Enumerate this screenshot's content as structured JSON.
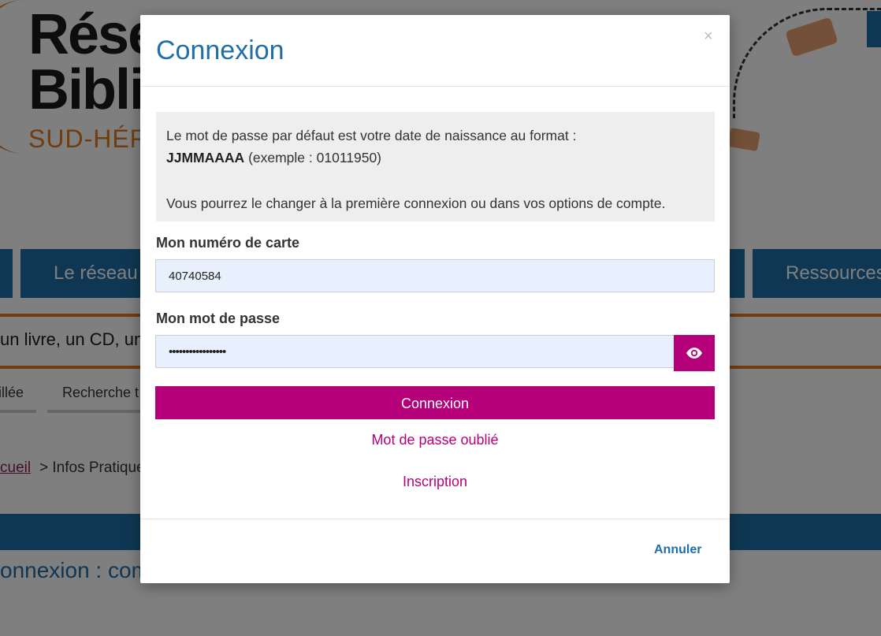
{
  "background": {
    "logo": {
      "line1": "Rése",
      "line2": "Bibli",
      "line3": "SUD-HÉR"
    },
    "nav": {
      "items": [
        "",
        "Le réseau",
        "",
        "Ressources"
      ]
    },
    "search": {
      "placeholder_visible": "un livre, un CD, un"
    },
    "subtabs": [
      "illée",
      "Recherche t"
    ],
    "breadcrumb": {
      "home": "cueil",
      "rest": "> Infos Pratique"
    },
    "heading": "onnexion : com"
  },
  "modal": {
    "title": "Connexion",
    "close_glyph": "×",
    "info": {
      "line1": "Le mot de passe par défaut est votre date de naissance au format :",
      "format_bold": "JJMMAAAA",
      "format_example": "(exemple : 01011950)",
      "line3": "Vous pourrez le changer à la première connexion ou dans vos options de compte."
    },
    "card_label": "Mon numéro de carte",
    "card_value": "40740584",
    "password_label": "Mon mot de passe",
    "password_value": "•••••••••••••••••",
    "submit_label": "Connexion",
    "forgot_label": "Mot de passe oublié",
    "register_label": "Inscription",
    "cancel_label": "Annuler"
  },
  "icons": {
    "show_password": "eye-icon",
    "close": "close-icon"
  },
  "colors": {
    "primary_blue": "#1f6fa6",
    "accent_magenta": "#b5007a",
    "orange": "#e07a1f"
  }
}
